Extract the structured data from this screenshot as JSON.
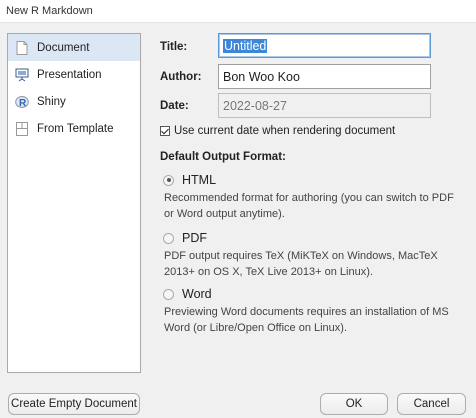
{
  "window": {
    "title": "New R Markdown"
  },
  "sidebar": {
    "items": [
      {
        "label": "Document",
        "icon": "document-icon",
        "selected": true
      },
      {
        "label": "Presentation",
        "icon": "presentation-icon",
        "selected": false
      },
      {
        "label": "Shiny",
        "icon": "shiny-r-icon",
        "selected": false
      },
      {
        "label": "From Template",
        "icon": "template-icon",
        "selected": false
      }
    ]
  },
  "form": {
    "title_label": "Title:",
    "title_value": "Untitled",
    "author_label": "Author:",
    "author_value": "Bon Woo Koo",
    "date_label": "Date:",
    "date_value": "2022-08-27",
    "use_current_date_label": "Use current date when rendering document",
    "use_current_date_checked": true,
    "output_format_label": "Default Output Format:",
    "formats": [
      {
        "label": "HTML",
        "checked": true,
        "description": "Recommended format for authoring (you can switch to PDF or Word output anytime)."
      },
      {
        "label": "PDF",
        "checked": false,
        "description": "PDF output requires TeX (MiKTeX on Windows, MacTeX 2013+ on OS X, TeX Live 2013+ on Linux)."
      },
      {
        "label": "Word",
        "checked": false,
        "description": "Previewing Word documents requires an installation of MS Word (or Libre/Open Office on Linux)."
      }
    ]
  },
  "buttons": {
    "create_empty": "Create Empty Document",
    "ok": "OK",
    "cancel": "Cancel"
  },
  "colors": {
    "selection_bg": "#dbe7f5",
    "text_highlight": "#3d87d8",
    "focus_border": "#5b9bd5"
  }
}
